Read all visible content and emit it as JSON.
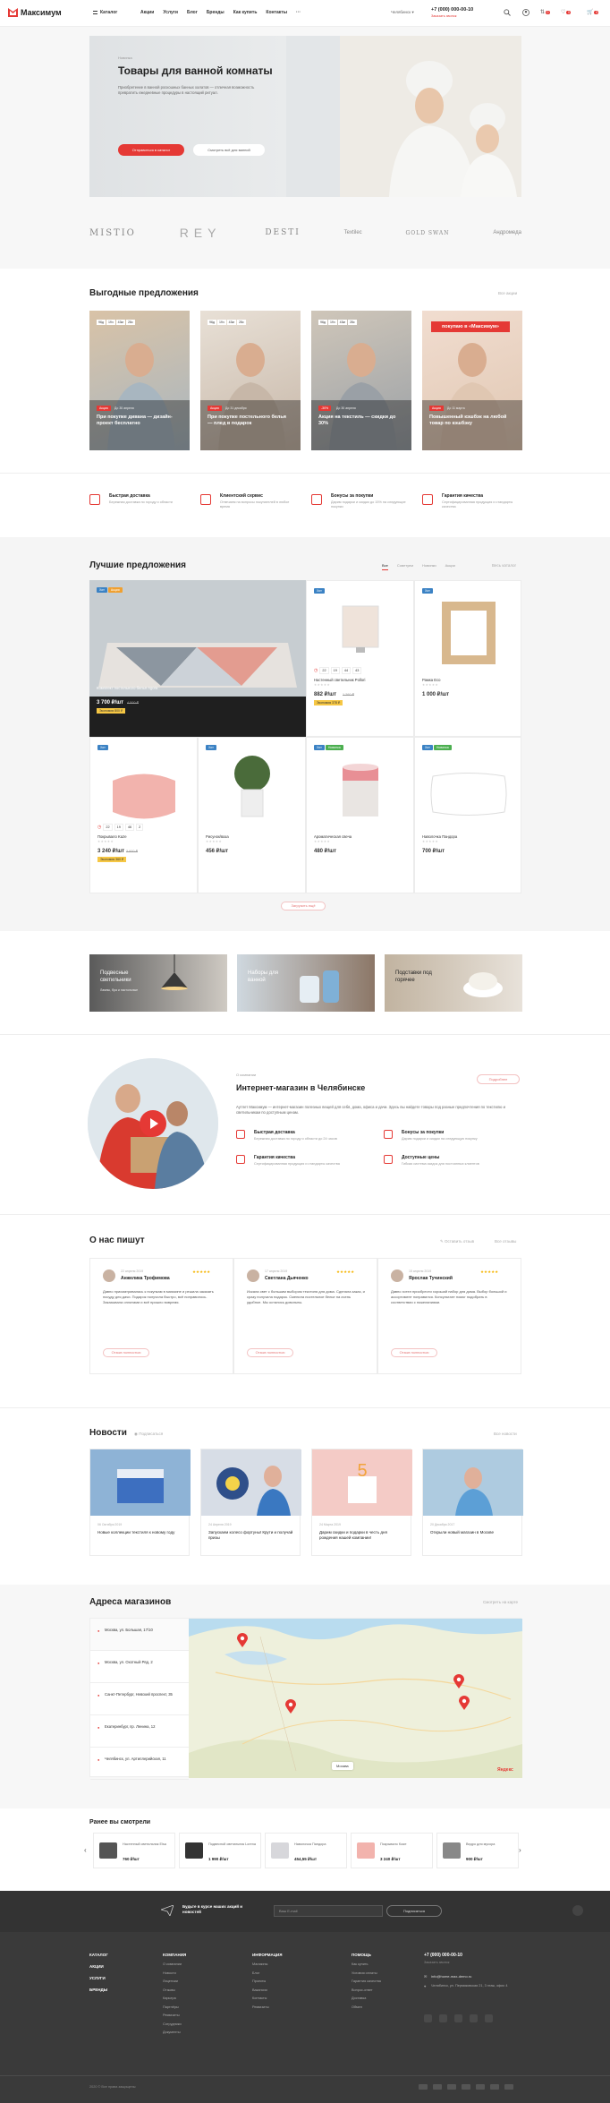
{
  "header": {
    "logo": "Максимум",
    "catalog": "Каталог",
    "nav": [
      "Акции",
      "Услуги",
      "Блог",
      "Бренды",
      "Как купить",
      "Контакты"
    ],
    "more": "···",
    "city": "Челябинск",
    "phone": "+7 (000) 000-00-10",
    "callback": "Заказать звонок",
    "badges": {
      "compare": "0",
      "favorites": "0",
      "cart": "0"
    }
  },
  "hero": {
    "small": "Новинка",
    "title": "Товары для ванной комнаты",
    "text": "Приобретение в ванной роскошных банных халатов — отличная возможность превратить ежедневные процедуры в настоящий ритуал.",
    "btn_primary": "Отправиться в каталог",
    "btn_secondary": "Смотреть всё для ванной"
  },
  "brands": [
    "MISTIO",
    "REY",
    "DESTI",
    "Textilec",
    "GOLD SWAN",
    "Андромеда"
  ],
  "offers": {
    "title": "Выгодные предложения",
    "all": "Все акции",
    "items": [
      {
        "badge": "Акция",
        "timer": [
          "96д",
          "19ч",
          "43м",
          "28с"
        ],
        "date": "До 30 апреля",
        "caption": "При покупке дивана — дизайн-проект бесплатно"
      },
      {
        "badge": "Акция",
        "timer": [
          "96д",
          "19ч",
          "43м",
          "28с"
        ],
        "date": "До 31 декабря",
        "caption": "При покупке постельного белья — плед в подарок"
      },
      {
        "badge": "-30%",
        "timer": [
          "96д",
          "19ч",
          "43м",
          "28с"
        ],
        "date": "До 30 апреля",
        "caption": "Акция на текстиль — скидки до 30%"
      },
      {
        "badge": "Акция",
        "timer": [],
        "date": "До 11 марта",
        "caption": "Повышенный кэшбэк на любой товар по кэшбэку",
        "banner": "покупаю в «Максимум»"
      }
    ]
  },
  "features": [
    {
      "title": "Быстрая доставка",
      "text": "Бережная доставка по городу и области"
    },
    {
      "title": "Клиентский сервис",
      "text": "Отвечаем на вопросы покупателей в любое время"
    },
    {
      "title": "Бонусы за покупки",
      "text": "Дарим подарки и скидки до 15% на следующие покупки"
    },
    {
      "title": "Гарантия качества",
      "text": "Сертифицированная продукция и стандарты качества"
    }
  ],
  "best": {
    "title": "Лучшие предложения",
    "tabs": [
      "Все",
      "Советуем",
      "Новинки",
      "Акции"
    ],
    "all": "Весь каталог",
    "products": [
      {
        "name": "Комплект постельного белья Agora",
        "price": "3 700 ₽/шт",
        "old": "4 500 ₽",
        "tags": [
          "Хит",
          "Акция"
        ],
        "saving": "Экономия 800 ₽"
      },
      {
        "name": "Настенный светильник Pollori",
        "price": "882 ₽/шт",
        "old": "1 260 ₽",
        "tags": [
          "Хит"
        ],
        "timer": [
          "22",
          "19",
          "44",
          "43"
        ],
        "saving": "Экономия 378 ₽"
      },
      {
        "name": "Рамка Eco",
        "price": "1 000 ₽/шт",
        "old": "",
        "tags": [
          "Хит"
        ],
        "saving": ""
      },
      {
        "name": "Покрывало Kaze",
        "price": "3 240 ₽/шт",
        "old": "3 600 ₽",
        "tags": [
          "Хит"
        ],
        "timer": [
          "22",
          "19",
          "46",
          "2"
        ],
        "saving": "Экономия 360 ₽"
      },
      {
        "name": "Рисунок/ваза",
        "price": "456 ₽/шт",
        "old": "",
        "tags": [
          "Хит"
        ],
        "saving": ""
      },
      {
        "name": "Ароматическая свеча",
        "price": "480 ₽/шт",
        "old": "",
        "tags": [
          "Хит",
          "Новинка"
        ],
        "saving": ""
      },
      {
        "name": "Наволочка Пандора",
        "price": "700 ₽/шт",
        "old": "",
        "tags": [
          "Хит",
          "Новинка"
        ],
        "saving": ""
      }
    ],
    "more": "Загрузить ещё"
  },
  "banners": [
    {
      "title": "Подвесные светильники",
      "text": "Лампы, бра и настольные"
    },
    {
      "title": "Наборы для ванной",
      "text": ""
    },
    {
      "title": "Подставки под горячее",
      "text": ""
    }
  ],
  "about": {
    "small": "О компании",
    "title": "Интернет-магазин в Челябинске",
    "btn": "Подробнее",
    "text": "Аутлет Максимум — интернет-магазин полезных вещей для себя, дома, офиса и дачи. Здесь вы найдете товары под разные предпочтения по текстилю и светильникам по доступным ценам.",
    "points": [
      {
        "title": "Быстрая доставка",
        "text": "Бережная доставка по городу и области до 24 часов"
      },
      {
        "title": "Бонусы за покупки",
        "text": "Дарим подарки и скидки на следующую покупку"
      },
      {
        "title": "Гарантия качества",
        "text": "Сертифицированная продукция и стандарты качества"
      },
      {
        "title": "Доступные цены",
        "text": "Гибкая система скидок для постоянных клиентов"
      }
    ]
  },
  "reviews": {
    "title": "О нас пишут",
    "write": "Оставить отзыв",
    "all": "Все отзывы",
    "items": [
      {
        "date": "22 апреля 2019",
        "name": "Анжелика Трофимова",
        "stars": "★★★★★",
        "text": "Давно присматривалась к покупкам в магазине и решила заказать посуду для дачи. Подарок получила быстро, всё понравилось. Заказывала оплатами и всё пришло вовремя.",
        "more": "Отзыв полностью"
      },
      {
        "date": "17 апреля 2019",
        "name": "Светлана Дьяченко",
        "stars": "★★★★★",
        "text": "Искала свет с большим выбором текстиля для дома. Сделала заказ, и сразу получила подарок. Сменила постельное белье на очень удобное. Мы остались довольны.",
        "more": "Отзыв полностью"
      },
      {
        "date": "15 апреля 2019",
        "name": "Ярослав Тучинский",
        "stars": "★★★★★",
        "text": "Давно хотел приобрести хороший набор для дома. Выбор большой и ассортимент понравился. Консультант помог подобрать в соответствии с пожеланиями.",
        "more": "Отзыв полностью"
      }
    ]
  },
  "news": {
    "title": "Новости",
    "sub": "Подписаться",
    "all": "Все новости",
    "items": [
      {
        "date": "06 Октября 2019",
        "title": "Новые коллекции текстиля к новому году"
      },
      {
        "date": "24 Апреля 2019",
        "title": "Запускаем колесо фортуны! Крути и получай призы"
      },
      {
        "date": "24 Марта 2019",
        "title": "Дарим скидки и подарки в честь дня рождения нашей компании!"
      },
      {
        "date": "20 Декабря 2017",
        "title": "Открыли новый магазин в Москве"
      }
    ]
  },
  "stores": {
    "title": "Адреса магазинов",
    "all": "Смотреть на карте",
    "list": [
      "Москва, ул. Большая, 17/10",
      "Москва, ул. Охотный Ряд, 2",
      "Санкт-Петербург, Невский проспект, 35",
      "Екатеринбург, пр. Ленина, 12",
      "Челябинск, ул. Артиллерийская, 11"
    ],
    "map_label": "Яндекс",
    "map_city": "Москва"
  },
  "viewed": {
    "title": "Ранее вы смотрели",
    "items": [
      {
        "name": "Настенный светильник Elsa",
        "price": "760 ₽/шт"
      },
      {
        "name": "Подвесной светильник Lorena",
        "price": "1 990 ₽/шт"
      },
      {
        "name": "Наволочка Пандора",
        "price": "454,55 ₽/шт"
      },
      {
        "name": "Покрывало Kaze",
        "price": "3 240 ₽/шт"
      },
      {
        "name": "Ведро для мусора",
        "price": "900 ₽/шт"
      }
    ]
  },
  "subscribe": {
    "text": "Будьте в курсе наших акций и новостей",
    "placeholder": "Ваш E-mail",
    "btn": "Подписаться"
  },
  "footer": {
    "col1": [
      "КАТАЛОГ",
      "АКЦИИ",
      "УСЛУГИ",
      "БРЕНДЫ"
    ],
    "col2_title": "КОМПАНИЯ",
    "col2": [
      "О компании",
      "Новости",
      "Лицензии",
      "Отзывы",
      "Карьера",
      "Партнёры",
      "Реквизиты",
      "Сотрудники",
      "Документы"
    ],
    "col3_title": "ИНФОРМАЦИЯ",
    "col3": [
      "Магазины",
      "Блог",
      "Проекты",
      "Вакансии",
      "Контакты",
      "Реквизиты"
    ],
    "col4_title": "ПОМОЩЬ",
    "col4": [
      "Как купить",
      "Условия оплаты",
      "Гарантия качества",
      "Вопрос-ответ",
      "Доставка",
      "Обмен"
    ],
    "phone": "+7 (000) 000-00-10",
    "callback": "Заказать звонок",
    "email": "info@home-max-demo.ru",
    "address": "Челябинск, ул. Пермяковская 21, 3 этаж, офис 4",
    "copyright": "2020 © Все права защищены"
  },
  "colors": {
    "accent": "#e53935",
    "dark": "#3a3a3a",
    "darker": "#2f2f2f",
    "gray": "#f5f5f5"
  }
}
